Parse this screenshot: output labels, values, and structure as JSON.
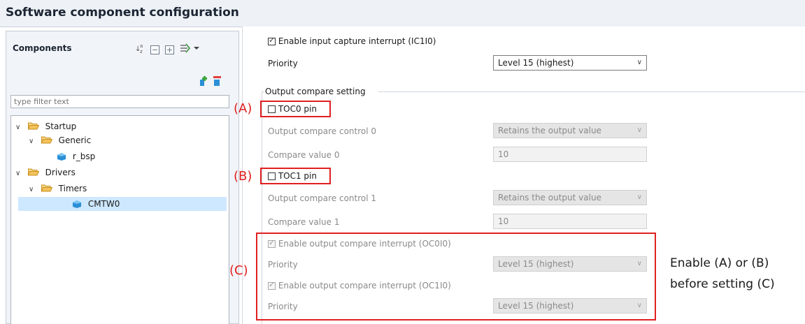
{
  "window": {
    "title": "Software component configuration"
  },
  "components_panel": {
    "label": "Components",
    "filter_placeholder": "type filter text",
    "tree": [
      {
        "label": "Startup"
      },
      {
        "label": "Generic"
      },
      {
        "label": "r_bsp"
      },
      {
        "label": "Drivers"
      },
      {
        "label": "Timers"
      },
      {
        "label": "CMTW0",
        "selected": true
      }
    ]
  },
  "settings": {
    "input_capture_interrupt": {
      "label": "Enable input capture interrupt (IC1I0)",
      "checked": true
    },
    "priority_ic": {
      "label": "Priority",
      "value": "Level 15 (highest)"
    },
    "output_compare_group": "Output compare setting",
    "toc0": {
      "label": "TOC0 pin",
      "checked": false
    },
    "occ0": {
      "label": "Output compare control 0",
      "value": "Retains the output value"
    },
    "cv0": {
      "label": "Compare value 0",
      "value": "10"
    },
    "toc1": {
      "label": "TOC1 pin",
      "checked": false
    },
    "occ1": {
      "label": "Output compare control 1",
      "value": "Retains the output value"
    },
    "cv1": {
      "label": "Compare value 1",
      "value": "10"
    },
    "oc0_interrupt": {
      "label": "Enable output compare interrupt (OC0I0)",
      "checked": true
    },
    "priority_oc0": {
      "label": "Priority",
      "value": "Level 15 (highest)"
    },
    "oc1_interrupt": {
      "label": "Enable output compare interrupt (OC1I0)",
      "checked": true
    },
    "priority_oc1": {
      "label": "Priority",
      "value": "Level 15 (highest)"
    }
  },
  "annotations": {
    "marker_a": "(A)",
    "marker_b": "(B)",
    "marker_c": "(C)",
    "note_line1": "Enable (A) or (B)",
    "note_line2": "before setting (C)",
    "highlight_color": "#e02020"
  },
  "colors": {
    "title_bg": "#eef2f7",
    "selection": "#cde8ff",
    "folder": "#e8a93a",
    "cube": "#2b8fd6"
  }
}
